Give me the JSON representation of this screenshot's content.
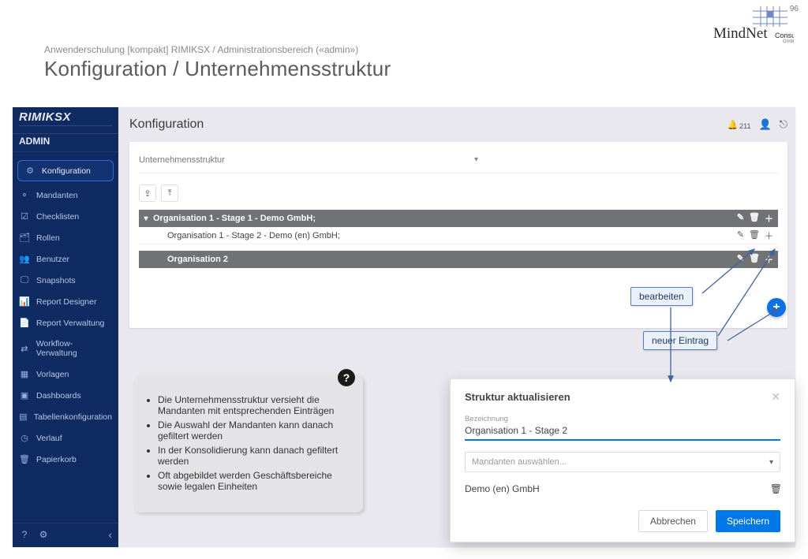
{
  "slide": {
    "page_number": "96",
    "kicker": "Anwenderschulung [kompakt] RIMIKSX / Administrationsbereich («admin»)",
    "title": "Konfiguration / Unternehmensstruktur",
    "logo_main": "MindNet",
    "logo_sub": "Consult",
    "logo_sub2": "GmbH"
  },
  "brand": {
    "product": "RIMIKSX",
    "area": "ADMIN"
  },
  "sidebar": {
    "items": [
      {
        "label": "Konfiguration",
        "icon": "⚙",
        "active": true
      },
      {
        "label": "Mandanten",
        "icon": "⚬",
        "active": false
      },
      {
        "label": "Checklisten",
        "icon": "☑",
        "active": false
      },
      {
        "label": "Rollen",
        "icon": "🗂",
        "active": false
      },
      {
        "label": "Benutzer",
        "icon": "👥",
        "active": false
      },
      {
        "label": "Snapshots",
        "icon": "🖵",
        "active": false
      },
      {
        "label": "Report Designer",
        "icon": "📊",
        "active": false
      },
      {
        "label": "Report Verwaltung",
        "icon": "📄",
        "active": false
      },
      {
        "label": "Workflow-Verwaltung",
        "icon": "⇄",
        "active": false
      },
      {
        "label": "Vorlagen",
        "icon": "▦",
        "active": false
      },
      {
        "label": "Dashboards",
        "icon": "▣",
        "active": false
      },
      {
        "label": "Tabellenkonfiguration",
        "icon": "▤",
        "active": false
      },
      {
        "label": "Verlauf",
        "icon": "◷",
        "active": false
      },
      {
        "label": "Papierkorb",
        "icon": "🗑",
        "active": false
      }
    ],
    "footer": {
      "help_icon": "?",
      "settings_icon": "⚙",
      "collapse_icon": "‹"
    }
  },
  "topbar": {
    "title": "Konfiguration",
    "notif_count": "211"
  },
  "panel": {
    "selector_value": "Unternehmensstruktur",
    "rows": [
      {
        "label": "Organisation 1 - Stage 1 - Demo GmbH;",
        "kind": "dark",
        "caret": "▾"
      },
      {
        "label": "Organisation 1 - Stage 2 - Demo (en) GmbH;",
        "kind": "light",
        "caret": ""
      },
      {
        "label": "Organisation 2",
        "kind": "dark",
        "caret": ""
      }
    ]
  },
  "callouts": {
    "edit": "bearbeiten",
    "new": "neuer Eintrag"
  },
  "help": {
    "bullets": [
      "Die Unternehmensstruktur versieht die Mandanten mit entsprechenden Einträgen",
      "Die Auswahl der Mandanten kann danach gefiltert werden",
      "In der Konsolidierung kann danach gefiltert werden",
      "Oft abgebildet werden Geschäftsbereiche sowie legalen Einheiten"
    ]
  },
  "dialog": {
    "title": "Struktur aktualisieren",
    "field_label": "Bezeichnung",
    "field_value": "Organisation 1 - Stage 2",
    "dropdown_placeholder": "Mandanten auswählen...",
    "chip": "Demo (en) GmbH",
    "cancel": "Abbrechen",
    "save": "Speichern"
  }
}
